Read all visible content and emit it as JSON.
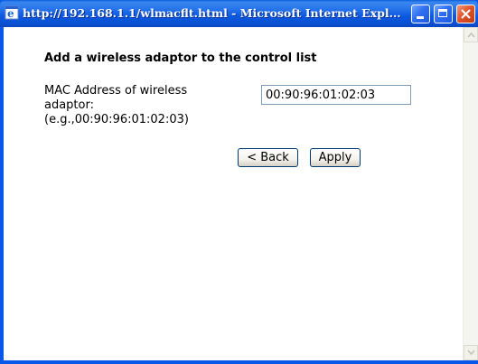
{
  "window": {
    "title": "http://192.168.1.1/wlmacflt.html - Microsoft Internet Expl..."
  },
  "form": {
    "heading": "Add a wireless adaptor to the control list",
    "mac_label_line1": "MAC Address of wireless",
    "mac_label_line2": "adaptor:",
    "mac_label_line3": "(e.g.,00:90:96:01:02:03)",
    "mac_value": "00:90:96:01:02:03",
    "back_label": "< Back",
    "apply_label": "Apply"
  },
  "colors": {
    "titlebar_blue": "#0a58ea",
    "close_red": "#e2542b"
  }
}
